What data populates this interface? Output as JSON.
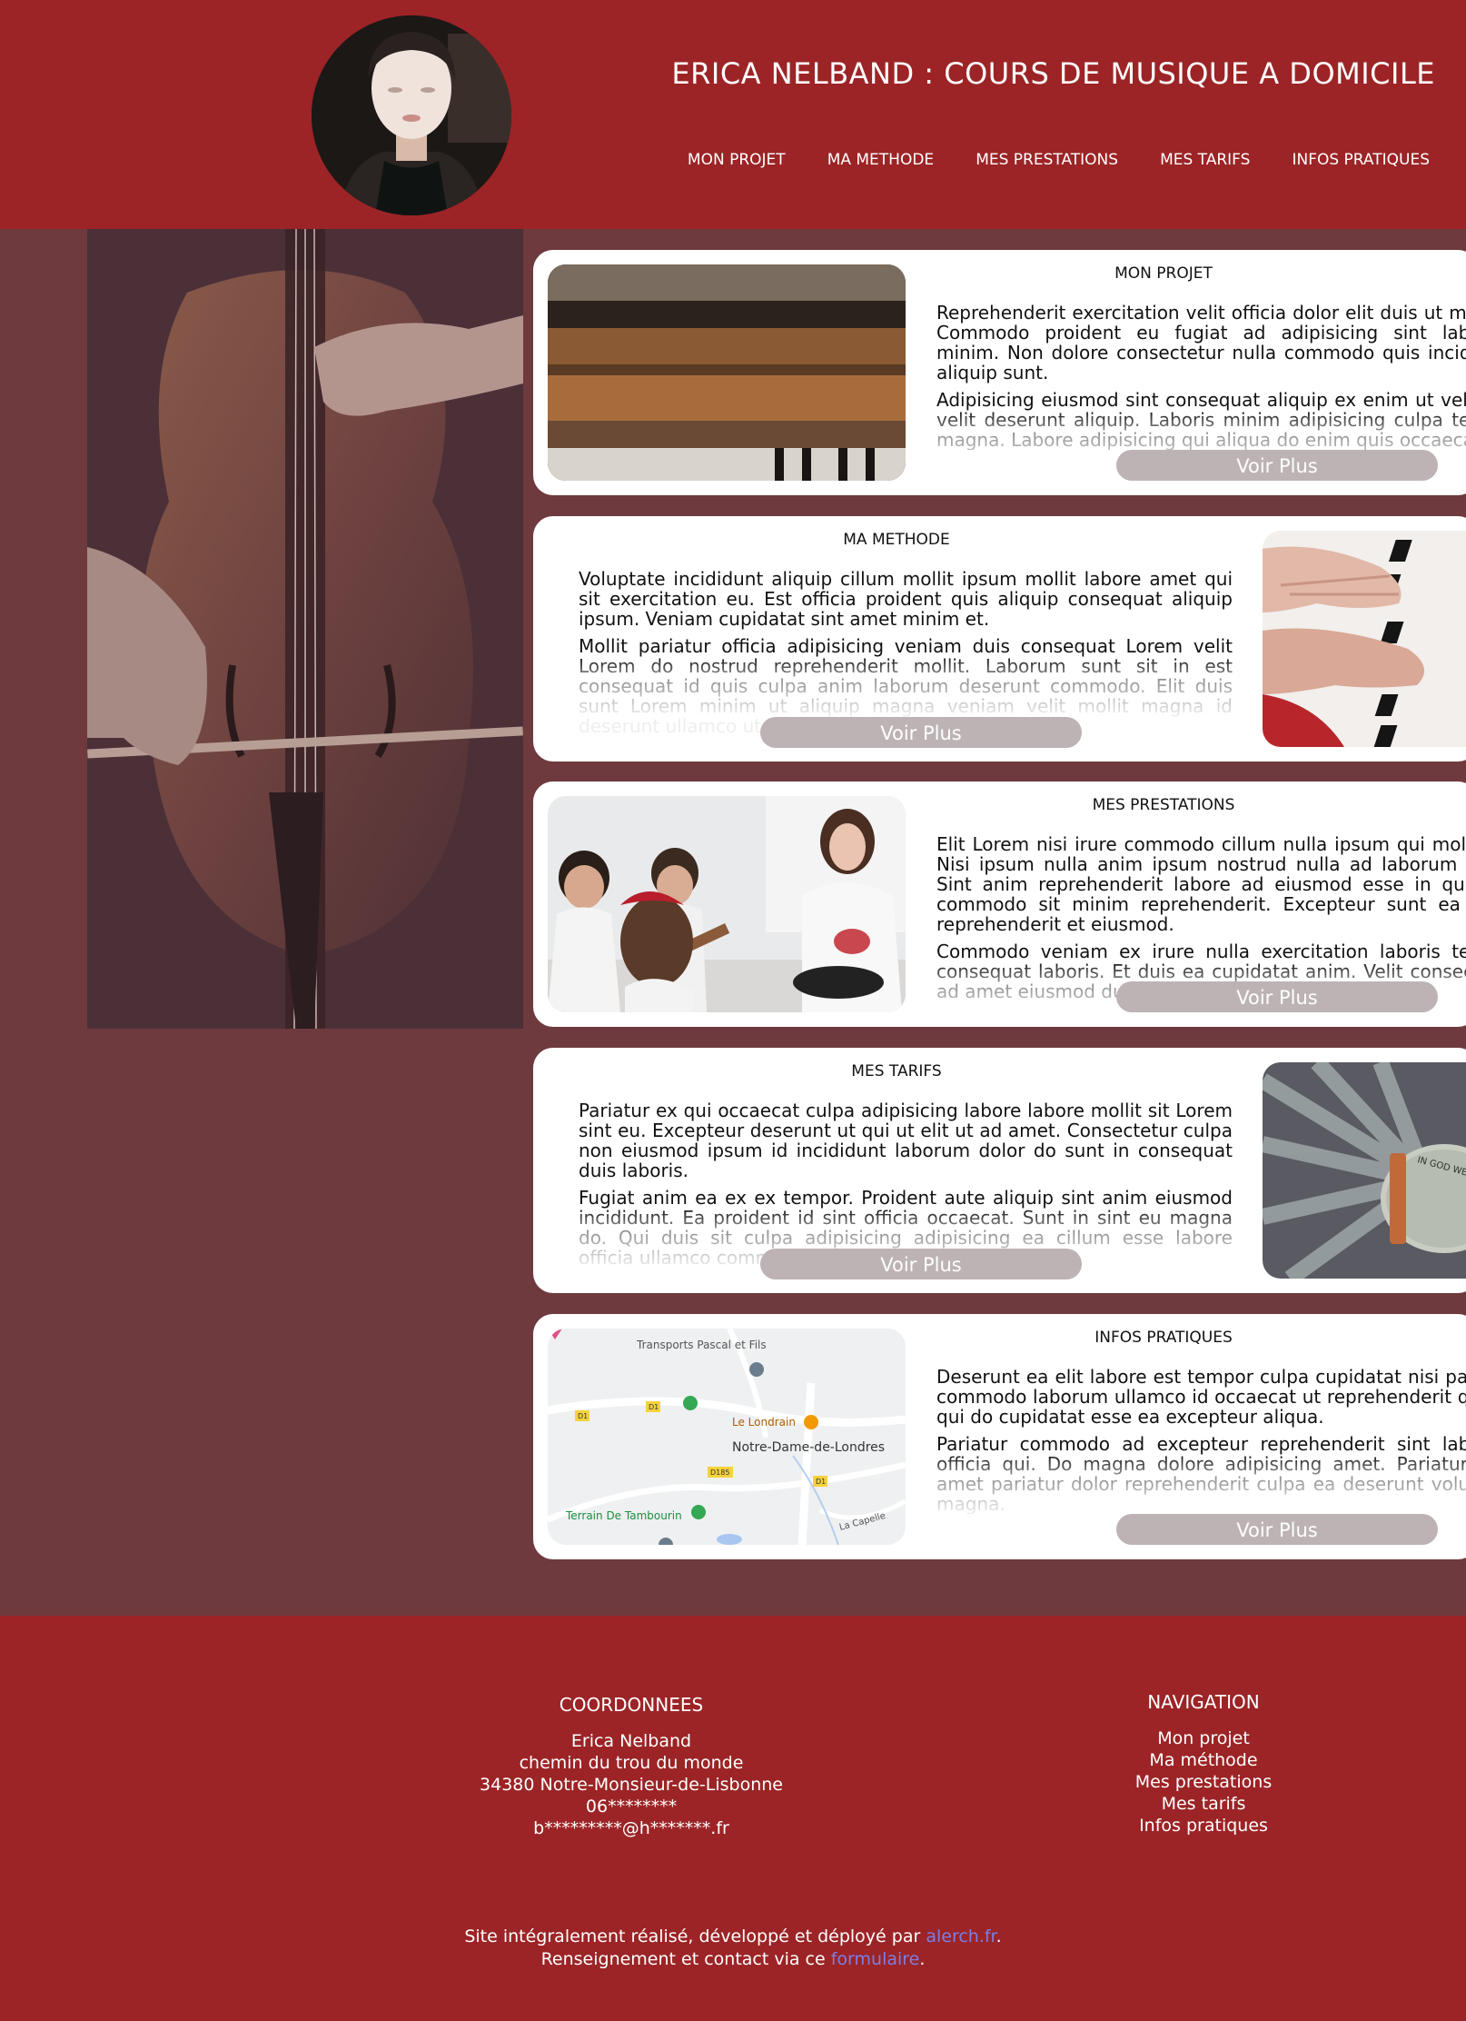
{
  "header": {
    "title": "ERICA NELBAND : COURS DE MUSIQUE A DOMICILE",
    "nav": [
      "MON PROJET",
      "MA METHODE",
      "MES PRESTATIONS",
      "MES TARIFS",
      "INFOS PRATIQUES"
    ]
  },
  "cards": [
    {
      "title": "MON PROJET",
      "p1": "Reprehenderit exercitation velit officia dolor elit duis ut magna. Commodo proident eu fugiat ad adipisicing sint laborum minim. Non dolore consectetur nulla commodo quis incididunt aliquip sunt.",
      "p2": "Adipisicing eiusmod sint consequat aliquip ex enim ut velit nisi velit deserunt aliquip. Laboris minim adipisicing culpa tempor magna. Labore adipisicing qui aliqua do enim quis occaecat.",
      "button": "Voir Plus"
    },
    {
      "title": "MA METHODE",
      "p1": "Voluptate incididunt aliquip cillum mollit ipsum mollit labore amet qui sit exercitation eu. Est officia proident quis aliquip consequat aliquip ipsum. Veniam cupidatat sint amet minim et.",
      "p2": "Mollit pariatur officia adipisicing veniam duis consequat Lorem velit Lorem do nostrud reprehenderit mollit. Laborum sunt sit in est consequat id quis culpa anim laborum deserunt commodo. Elit duis sunt Lorem minim ut aliquip magna veniam velit mollit magna id deserunt ullamco ut pariatur magna ullamco id.",
      "button": "Voir Plus"
    },
    {
      "title": "MES PRESTATIONS",
      "p1": "Elit Lorem nisi irure commodo cillum nulla ipsum qui mollit ex. Nisi ipsum nulla anim ipsum nostrud nulla ad laborum anim. Sint anim reprehenderit labore ad eiusmod esse in quis est commodo sit minim reprehenderit. Excepteur sunt ea enim reprehenderit et eiusmod.",
      "p2": "Commodo veniam ex irure nulla exercitation laboris tempor consequat laboris. Et duis ea cupidatat anim. Velit consectetur ad amet eiusmod duis excepteur cillum.",
      "button": "Voir Plus"
    },
    {
      "title": "MES TARIFS",
      "p1": "Pariatur ex qui occaecat culpa adipisicing labore labore mollit sit Lorem sint eu. Excepteur deserunt ut qui ut elit ut ad amet. Consectetur culpa non eiusmod ipsum id incididunt laborum dolor do sunt in consequat duis laboris.",
      "p2": "Fugiat anim ea ex ex tempor. Proident aute aliquip sint anim eiusmod incididunt. Ea proident id sint officia occaecat. Sunt in sint eu magna do. Qui duis sit culpa adipisicing adipisicing ea cillum esse labore officia ullamco commodo nisi.",
      "button": "Voir Plus"
    },
    {
      "title": "INFOS PRATIQUES",
      "p1": "Deserunt ea elit labore est tempor culpa cupidatat nisi pariatur commodo laborum ullamco id occaecat ut reprehenderit quis in qui do cupidatat esse ea excepteur aliqua.",
      "p2": "Pariatur commodo ad excepteur reprehenderit sint laborum officia qui. Do magna dolore adipisicing amet. Pariatur velit amet pariatur dolor reprehenderit culpa ea deserunt voluptate magna.",
      "button": "Voir Plus"
    }
  ],
  "map_labels": {
    "transport": "Transports Pascal et Fils",
    "londrain": "Le Londrain",
    "town": "Notre-Dame-de-Londres",
    "terrain": "Terrain De Tambourin",
    "capelle": "La Capelle",
    "d1": "D1",
    "d185": "D185"
  },
  "money_text": "IN GOD WE TRUST",
  "footer": {
    "coords_title": "COORDONNEES",
    "name": "Erica Nelband",
    "street": "chemin du trou du monde",
    "city": "34380 Notre-Monsieur-de-Lisbonne",
    "phone": "06********",
    "email": "b*********@h*******.fr",
    "nav_title": "NAVIGATION",
    "nav": [
      "Mon projet",
      "Ma méthode",
      "Mes prestations",
      "Mes tarifs",
      "Infos pratiques"
    ],
    "credit1_prefix": "Site intégralement réalisé, développé et déployé par ",
    "credit1_link": "alerch.fr",
    "credit1_suffix": ".",
    "credit2_prefix": "Renseignement et contact via ce ",
    "credit2_link": "formulaire",
    "credit2_suffix": "."
  },
  "colors": {
    "header_bg": "#9c2426",
    "page_bg": "#6e3a3d",
    "button_bg": "#bdb3b4",
    "link": "#7a7ee6"
  }
}
